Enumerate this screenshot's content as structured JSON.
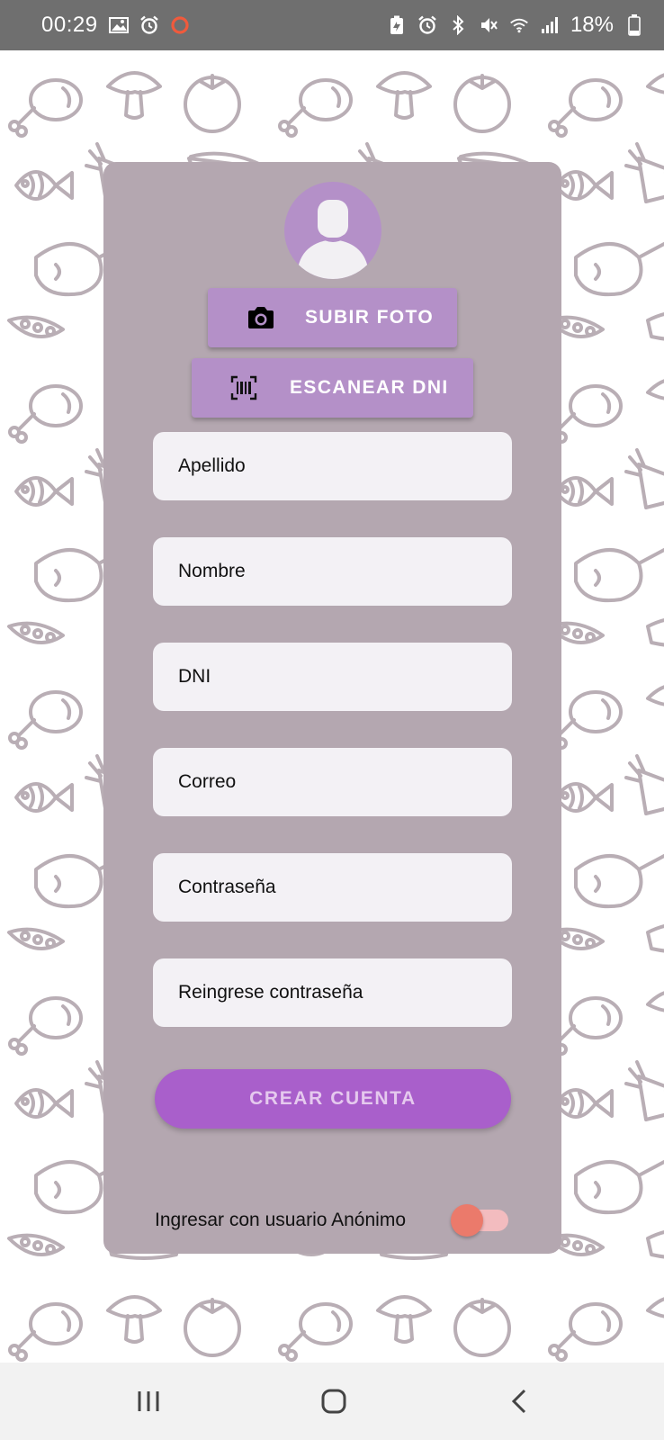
{
  "status_bar": {
    "time": "00:29",
    "battery": "18%",
    "left_icons": [
      "image-icon",
      "alarm-icon",
      "record-icon"
    ],
    "right_icons": [
      "battery-saver-icon",
      "alarm-icon",
      "bluetooth-icon",
      "mute-icon",
      "wifi-icon",
      "signal-icon",
      "battery-icon"
    ]
  },
  "profile": {
    "avatar_icon": "person-icon"
  },
  "actions": {
    "upload_photo_label": "SUBIR FOTO",
    "upload_photo_icon": "camera-icon",
    "scan_dni_label": "ESCANEAR DNI",
    "scan_dni_icon": "barcode-scan-icon"
  },
  "form": {
    "fields": [
      {
        "placeholder": "Apellido",
        "value": ""
      },
      {
        "placeholder": "Nombre",
        "value": ""
      },
      {
        "placeholder": "DNI",
        "value": ""
      },
      {
        "placeholder": "Correo",
        "value": ""
      },
      {
        "placeholder": "Contraseña",
        "value": ""
      },
      {
        "placeholder": "Reingrese contraseña",
        "value": ""
      }
    ],
    "submit_label": "CREAR CUENTA"
  },
  "anonymous": {
    "label": "Ingresar con usuario Anónimo",
    "enabled": false
  },
  "colors": {
    "card": "#b4a7b0",
    "accent": "#b490c8",
    "submit": "#a95fcb",
    "toggle_thumb": "#eb7a6b",
    "pattern_stroke": "#b9aeb5"
  },
  "nav_bar": {
    "icons": [
      "recent-apps-icon",
      "home-icon",
      "back-icon"
    ]
  }
}
